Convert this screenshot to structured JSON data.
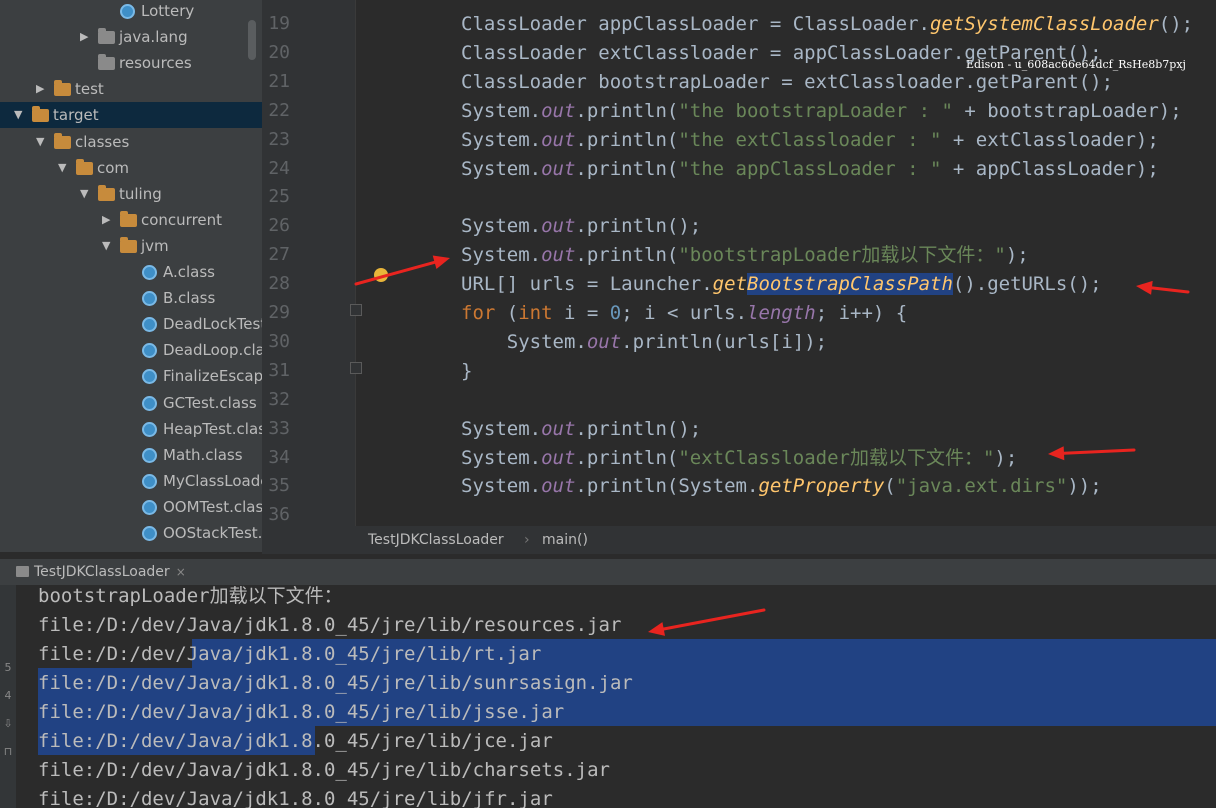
{
  "project_tree": {
    "items": [
      {
        "label": "Lottery",
        "icon": "class-icon",
        "depth": 4,
        "arrow": ""
      },
      {
        "label": "java.lang",
        "icon": "package-icon",
        "depth": 3,
        "arrow": "▶"
      },
      {
        "label": "resources",
        "icon": "resources-folder-icon",
        "depth": 3,
        "arrow": ""
      },
      {
        "label": "test",
        "icon": "folder-icon",
        "depth": 1,
        "arrow": "▶"
      },
      {
        "label": "target",
        "icon": "folder-icon",
        "depth": 0,
        "arrow": "▼"
      },
      {
        "label": "classes",
        "icon": "folder-icon",
        "depth": 1,
        "arrow": "▼"
      },
      {
        "label": "com",
        "icon": "folder-icon",
        "depth": 2,
        "arrow": "▼"
      },
      {
        "label": "tuling",
        "icon": "folder-icon",
        "depth": 3,
        "arrow": "▼"
      },
      {
        "label": "concurrent",
        "icon": "folder-icon",
        "depth": 4,
        "arrow": "▶"
      },
      {
        "label": "jvm",
        "icon": "folder-icon",
        "depth": 4,
        "arrow": "▼"
      },
      {
        "label": "A.class",
        "icon": "class-icon",
        "depth": 5,
        "arrow": ""
      },
      {
        "label": "B.class",
        "icon": "class-icon",
        "depth": 5,
        "arrow": ""
      },
      {
        "label": "DeadLockTest.c",
        "icon": "class-icon",
        "depth": 5,
        "arrow": ""
      },
      {
        "label": "DeadLoop.class",
        "icon": "class-icon",
        "depth": 5,
        "arrow": ""
      },
      {
        "label": "FinalizeEscapeG",
        "icon": "class-icon",
        "depth": 5,
        "arrow": ""
      },
      {
        "label": "GCTest.class",
        "icon": "class-icon",
        "depth": 5,
        "arrow": ""
      },
      {
        "label": "HeapTest.class",
        "icon": "class-icon",
        "depth": 5,
        "arrow": ""
      },
      {
        "label": "Math.class",
        "icon": "class-icon",
        "depth": 5,
        "arrow": ""
      },
      {
        "label": "MyClassLoader",
        "icon": "class-icon",
        "depth": 5,
        "arrow": ""
      },
      {
        "label": "OOMTest.class",
        "icon": "class-icon",
        "depth": 5,
        "arrow": ""
      },
      {
        "label": "OOStackTest.cl",
        "icon": "class-icon",
        "depth": 5,
        "arrow": ""
      }
    ]
  },
  "editor": {
    "line_numbers": [
      "19",
      "20",
      "21",
      "22",
      "23",
      "24",
      "25",
      "26",
      "27",
      "28",
      "29",
      "30",
      "31",
      "32",
      "33",
      "34",
      "35",
      "36"
    ],
    "lines": [
      {
        "n": "19",
        "tokens": [
          [
            "t",
            "ClassLoader appClassLoader = ClassLoader."
          ],
          [
            "m",
            "getSystemClassLoader"
          ],
          [
            "t",
            "();"
          ]
        ]
      },
      {
        "n": "20",
        "tokens": [
          [
            "t",
            "ClassLoader extClassloader = appClassLoader.getParent();"
          ]
        ]
      },
      {
        "n": "21",
        "tokens": [
          [
            "t",
            "ClassLoader bootstrapLoader = extClassloader.getParent();"
          ]
        ]
      },
      {
        "n": "22",
        "tokens": [
          [
            "t",
            "System."
          ],
          [
            "f",
            "out"
          ],
          [
            "t",
            ".println("
          ],
          [
            "s",
            "\"the bootstrapLoader : \""
          ],
          [
            "t",
            " + bootstrapLoader);"
          ]
        ]
      },
      {
        "n": "23",
        "tokens": [
          [
            "t",
            "System."
          ],
          [
            "f",
            "out"
          ],
          [
            "t",
            ".println("
          ],
          [
            "s",
            "\"the extClassloader : \""
          ],
          [
            "t",
            " + extClassloader);"
          ]
        ]
      },
      {
        "n": "24",
        "tokens": [
          [
            "t",
            "System."
          ],
          [
            "f",
            "out"
          ],
          [
            "t",
            ".println("
          ],
          [
            "s",
            "\"the appClassLoader : \""
          ],
          [
            "t",
            " + appClassLoader);"
          ]
        ]
      },
      {
        "n": "25",
        "tokens": []
      },
      {
        "n": "26",
        "tokens": [
          [
            "t",
            "System."
          ],
          [
            "f",
            "out"
          ],
          [
            "t",
            ".println();"
          ]
        ]
      },
      {
        "n": "27",
        "tokens": [
          [
            "t",
            "System."
          ],
          [
            "f",
            "out"
          ],
          [
            "t",
            ".println("
          ],
          [
            "s",
            "\"bootstrapLoader加载以下文件：\""
          ],
          [
            "t",
            ");"
          ]
        ]
      },
      {
        "n": "28",
        "tokens": [
          [
            "t",
            "URL[] urls = Launcher."
          ],
          [
            "m",
            "get"
          ],
          [
            "mh",
            "BootstrapClassPath"
          ],
          [
            "t",
            "().getURLs();"
          ]
        ]
      },
      {
        "n": "29",
        "tokens": [
          [
            "k",
            "for"
          ],
          [
            "t",
            " ("
          ],
          [
            "k",
            "int"
          ],
          [
            "t",
            " i = "
          ],
          [
            "n",
            "0"
          ],
          [
            "t",
            "; i < urls."
          ],
          [
            "f",
            "length"
          ],
          [
            "t",
            "; i++) {"
          ]
        ]
      },
      {
        "n": "30",
        "tokens": [
          [
            "t",
            "    System."
          ],
          [
            "f",
            "out"
          ],
          [
            "t",
            ".println(urls[i]);"
          ]
        ]
      },
      {
        "n": "31",
        "tokens": [
          [
            "t",
            "}"
          ]
        ]
      },
      {
        "n": "32",
        "tokens": []
      },
      {
        "n": "33",
        "tokens": [
          [
            "t",
            "System."
          ],
          [
            "f",
            "out"
          ],
          [
            "t",
            ".println();"
          ]
        ]
      },
      {
        "n": "34",
        "tokens": [
          [
            "t",
            "System."
          ],
          [
            "f",
            "out"
          ],
          [
            "t",
            ".println("
          ],
          [
            "s",
            "\"extClassloader加载以下文件：\""
          ],
          [
            "t",
            ");"
          ]
        ]
      },
      {
        "n": "35",
        "tokens": [
          [
            "t",
            "System."
          ],
          [
            "f",
            "out"
          ],
          [
            "t",
            ".println(System."
          ],
          [
            "m",
            "getProperty"
          ],
          [
            "t",
            "("
          ],
          [
            "s",
            "\"java.ext.dirs\""
          ],
          [
            "t",
            "));"
          ]
        ]
      },
      {
        "n": "36",
        "tokens": []
      }
    ],
    "watermark": "Edison - u_608ac66e64dcf_RsHe8b7pxj"
  },
  "breadcrumb": {
    "items": [
      "TestJDKClassLoader",
      "main()"
    ],
    "separator": "›"
  },
  "run_panel": {
    "tab_label": "TestJDKClassLoader",
    "close_glyph": "×",
    "side_glyphs": [
      "5",
      "4",
      "⇩",
      "⊓"
    ],
    "output_lines": [
      "bootstrapLoader加载以下文件：",
      "file:/D:/dev/Java/jdk1.8.0_45/jre/lib/resources.jar",
      "file:/D:/dev/Java/jdk1.8.0_45/jre/lib/rt.jar",
      "file:/D:/dev/Java/jdk1.8.0_45/jre/lib/sunrsasign.jar",
      "file:/D:/dev/Java/jdk1.8.0_45/jre/lib/jsse.jar",
      "file:/D:/dev/Java/jdk1.8.0_45/jre/lib/jce.jar",
      "file:/D:/dev/Java/jdk1.8.0_45/jre/lib/charsets.jar",
      "file:/D:/dev/Java/jdk1.8.0_45/jre/lib/jfr.jar"
    ]
  },
  "colors": {
    "annotation_arrow": "#e8241f",
    "selection": "#214283",
    "folder": "#c78b3c",
    "class_icon": "#3f8fc7"
  }
}
